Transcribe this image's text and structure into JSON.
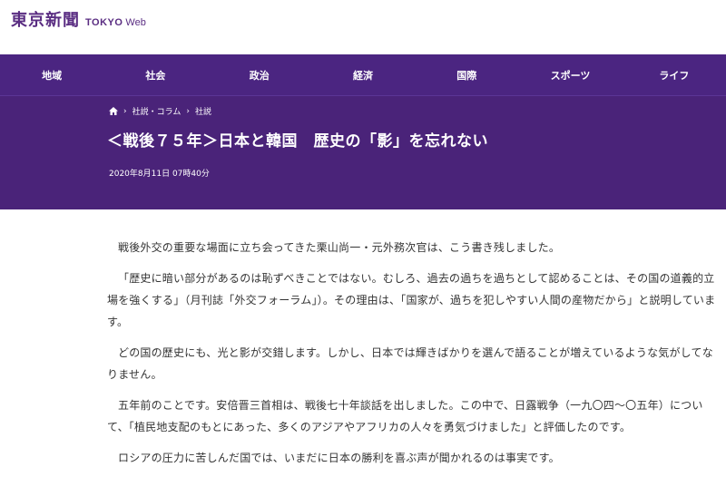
{
  "header": {
    "logo_main": "東京新聞",
    "logo_tokyo": "TOKYO",
    "logo_web": "Web",
    "brand_color": "#5a2d82"
  },
  "nav": {
    "items": [
      {
        "label": "地域"
      },
      {
        "label": "社会"
      },
      {
        "label": "政治"
      },
      {
        "label": "経済"
      },
      {
        "label": "国際"
      },
      {
        "label": "スポーツ"
      },
      {
        "label": "ライフ"
      }
    ],
    "bg_color": "#4b2581"
  },
  "breadcrumb": {
    "home_icon": "home-icon",
    "items": [
      {
        "label": "社説・コラム"
      },
      {
        "label": "社説"
      }
    ]
  },
  "article": {
    "title": "＜戦後７５年＞日本と韓国　歴史の「影」を忘れない",
    "date": "2020年8月11日 07時40分",
    "paragraphs": [
      "戦後外交の重要な場面に立ち会ってきた栗山尚一・元外務次官は、こう書き残しました。",
      "「歴史に暗い部分があるのは恥ずべきことではない。むしろ、過去の過ちを過ちとして認めることは、その国の道義的立場を強くする」（月刊誌「外交フォーラム」）。その理由は、「国家が、過ちを犯しやすい人間の産物だから」と説明しています。",
      "どの国の歴史にも、光と影が交錯します。しかし、日本では輝きばかりを選んで語ることが増えているような気がしてなりません。",
      "五年前のことです。安倍晋三首相は、戦後七十年談話を出しました。この中で、日露戦争（一九〇四～〇五年）について、「植民地支配のもとにあった、多くのアジアやアフリカの人々を勇気づけました」と評価したのです。",
      "ロシアの圧力に苦しんだ国では、いまだに日本の勝利を喜ぶ声が聞かれるのは事実です。"
    ]
  }
}
